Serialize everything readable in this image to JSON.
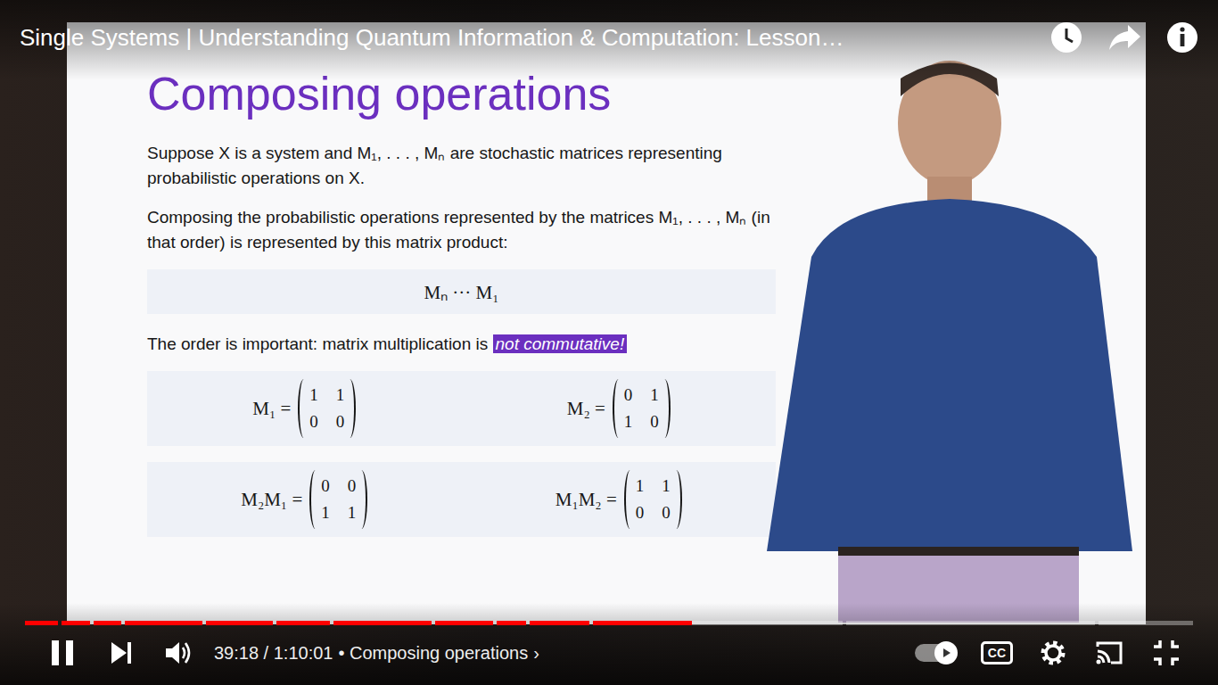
{
  "video_title": "Single Systems | Understanding Quantum Information & Computation: Lesson…",
  "slide": {
    "heading": "Composing operations",
    "paragraphs": [
      "Suppose X is a system and M₁, . . . , Mₙ are stochastic matrices representing probabilistic operations on X.",
      "Composing the probabilistic operations represented by the matrices M₁, . . . , Mₙ (in that order) is represented by this matrix product:"
    ],
    "equation": "Mₙ ··· M₁",
    "note": {
      "text": "The order is important: matrix multiplication is ",
      "highlight": "not commutative!"
    },
    "matrices": [
      {
        "label": "M₁ =",
        "rows": [
          [
            "1",
            "1"
          ],
          [
            "0",
            "0"
          ]
        ]
      },
      {
        "label": "M₂ =",
        "rows": [
          [
            "0",
            "1"
          ],
          [
            "1",
            "0"
          ]
        ]
      }
    ],
    "products": [
      {
        "label": "M₂M₁ =",
        "rows": [
          [
            "0",
            "0"
          ],
          [
            "1",
            "1"
          ]
        ]
      },
      {
        "label": "M₁M₂ =",
        "rows": [
          [
            "1",
            "1"
          ],
          [
            "0",
            "0"
          ]
        ]
      }
    ]
  },
  "player": {
    "playing": true,
    "time": "39:18 / 1:10:01",
    "chapter": "• Composing operations",
    "chapter_chevron": "›",
    "autoplay": true,
    "captions_label": "CC",
    "captions_on": false,
    "progress": {
      "level": 0.561,
      "chapter_shares": [
        38,
        34,
        32,
        90,
        78,
        62,
        114,
        68,
        34,
        70,
        290,
        290,
        110
      ]
    }
  }
}
